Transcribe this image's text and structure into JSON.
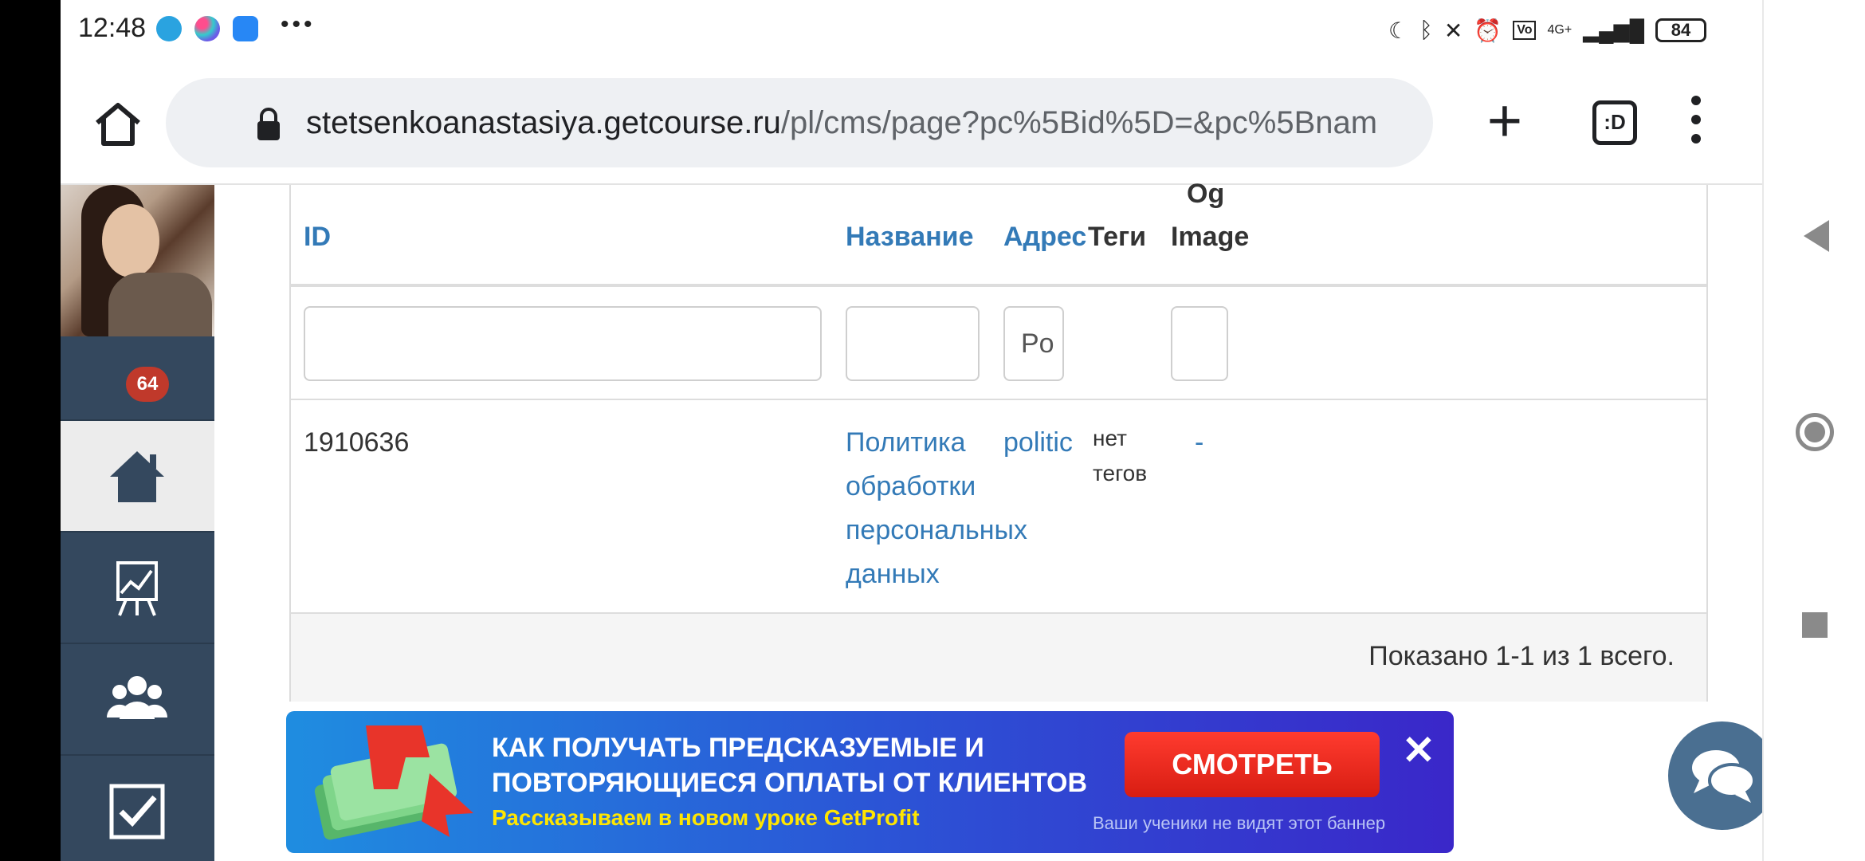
{
  "status_bar": {
    "time": "12:48",
    "battery": "84",
    "network": "4G+"
  },
  "browser": {
    "url_host": "stetsenkoanastasiya.getcourse.ru",
    "url_path": "/pl/cms/page?pc%5Bid%5D=&pc%5Bnam",
    "tabs_label": ":D"
  },
  "sidebar": {
    "notification_count": "64"
  },
  "table": {
    "headers": {
      "id": "ID",
      "name": "Название",
      "address": "Адрес",
      "tags": "Теги",
      "og_image_line1": "Og",
      "og_image_line2": "Image"
    },
    "filters": {
      "id": "",
      "name": "",
      "address": "Po",
      "og_image": ""
    },
    "rows": [
      {
        "id": "1910636",
        "name_lines": [
          "Политика",
          "обработки",
          "персональных",
          "данных"
        ],
        "address": "politic",
        "tags_lines": [
          "нет",
          "тегов"
        ],
        "og_image": "-"
      }
    ],
    "summary": "Показано 1-1 из 1 всего."
  },
  "banner": {
    "title_line1": "КАК ПОЛУЧАТЬ ПРЕДСКАЗУЕМЫЕ И",
    "title_line2": "ПОВТОРЯЮЩИЕСЯ ОПЛАТЫ ОТ КЛИЕНТОВ",
    "subtitle": "Рассказываем в новом уроке GetProfit",
    "button": "СМОТРЕТЬ",
    "close": "✕",
    "note": "Ваши ученики не видят этот баннер"
  }
}
